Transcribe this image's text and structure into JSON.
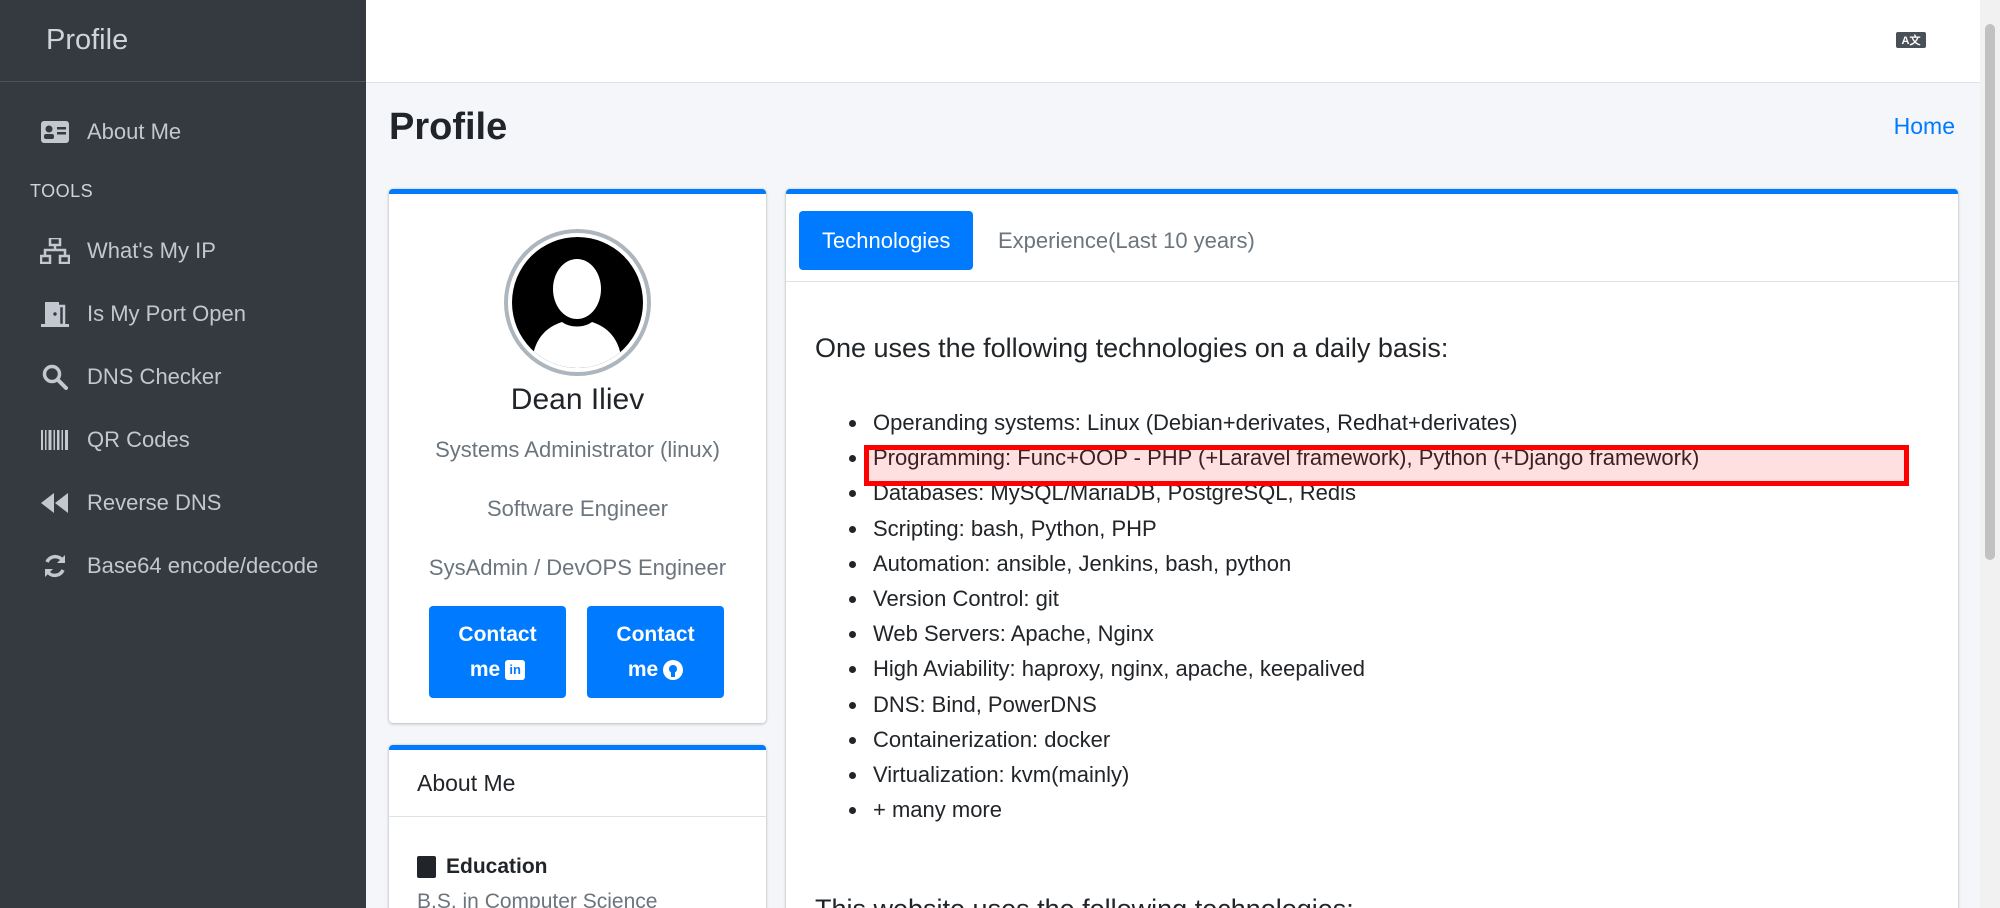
{
  "sidebar": {
    "brand": "Profile",
    "about_me": "About Me",
    "tools_header": "TOOLS",
    "items": [
      {
        "label": "What's My IP",
        "icon": "network-icon"
      },
      {
        "label": "Is My Port Open",
        "icon": "door-icon"
      },
      {
        "label": "DNS Checker",
        "icon": "search-icon"
      },
      {
        "label": "QR Codes",
        "icon": "barcode-icon"
      },
      {
        "label": "Reverse DNS",
        "icon": "rewind-icon"
      },
      {
        "label": "Base64 encode/decode",
        "icon": "sync-icon"
      }
    ]
  },
  "header": {
    "title": "Profile",
    "breadcrumb": "Home",
    "language_icon": "translate-icon"
  },
  "profile": {
    "name": "Dean Iliev",
    "roles": [
      "Systems Administrator (linux)",
      "Software Engineer",
      "SysAdmin / DevOPS Engineer"
    ],
    "contact_label": "Contact",
    "contact_me": "me",
    "linkedin_icon": "in",
    "github_icon": "gh"
  },
  "about": {
    "title": "About Me",
    "education_label": "Education",
    "education_text": "B.S. in Computer Science"
  },
  "tabs": {
    "technologies": "Technologies",
    "experience": "Experience(Last 10 years)"
  },
  "technologies": {
    "lead": "One uses the following technologies on a daily basis:",
    "items": [
      "Operanding systems: Linux (Debian+derivates, Redhat+derivates)",
      "Programming: Func+OOP - PHP (+Laravel framework), Python (+Django framework)",
      "Databases: MySQL/MariaDB, PostgreSQL, Redis",
      "Scripting: bash, Python, PHP",
      "Automation: ansible, Jenkins, bash, python",
      "Version Control: git",
      "Web Servers: Apache, Nginx",
      "High Aviability: haproxy, nginx, apache, keepalived",
      "DNS: Bind, PowerDNS",
      "Containerization: docker",
      "Virtualization: kvm(mainly)",
      "+ many more"
    ],
    "website_lead": "This website uses the following technologies:"
  },
  "colors": {
    "accent": "#007bff",
    "sidebar_bg": "#343a40",
    "highlight": "#ff0000"
  }
}
